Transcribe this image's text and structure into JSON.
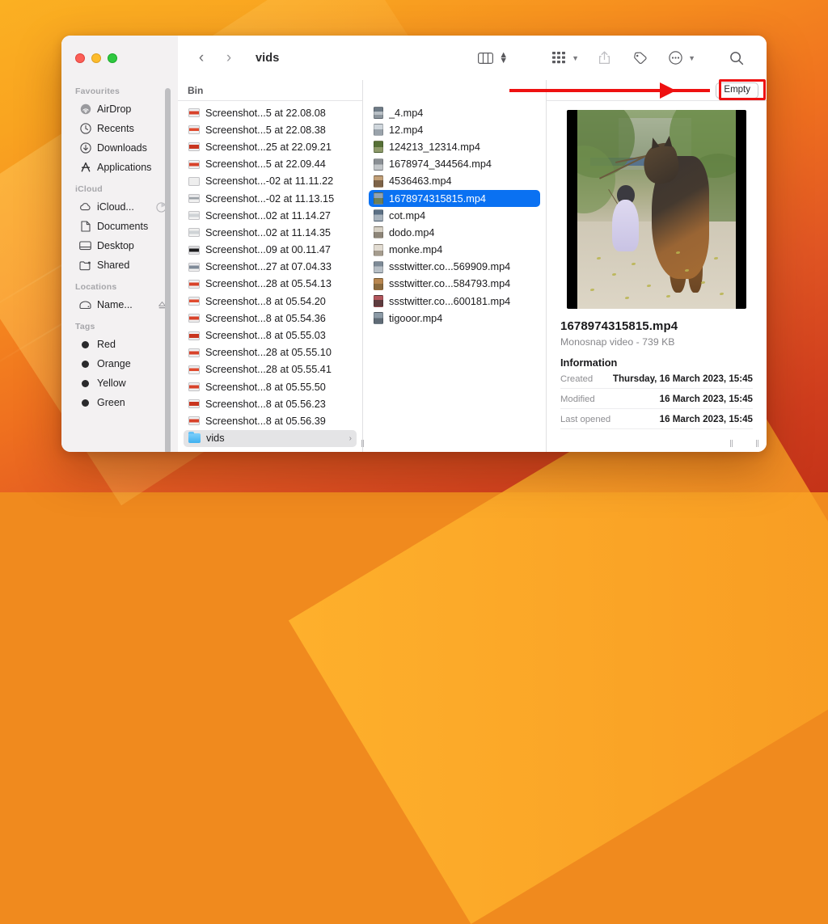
{
  "window": {
    "title": "vids",
    "traffic_lights": [
      "close",
      "minimize",
      "maximize"
    ]
  },
  "toolbar": {
    "back_icon": "chevron-left-icon",
    "forward_icon": "chevron-right-icon",
    "view_icon": "column-view-icon",
    "stepper_icon": "up-down-stepper-icon",
    "group_icon": "group-by-icon",
    "share_icon": "share-icon",
    "tag_icon": "tag-icon",
    "more_icon": "more-ellipsis-icon",
    "search_icon": "search-icon"
  },
  "bin_bar": {
    "title": "Bin",
    "empty_label": "Empty"
  },
  "sidebar": {
    "sections": [
      {
        "label": "Favourites",
        "items": [
          {
            "label": "AirDrop",
            "icon": "airdrop-icon"
          },
          {
            "label": "Recents",
            "icon": "clock-icon"
          },
          {
            "label": "Downloads",
            "icon": "download-icon"
          },
          {
            "label": "Applications",
            "icon": "applications-icon"
          }
        ]
      },
      {
        "label": "iCloud",
        "items": [
          {
            "label": "iCloud...",
            "icon": "cloud-icon",
            "trailing": "sync-progress-icon"
          },
          {
            "label": "Documents",
            "icon": "document-icon"
          },
          {
            "label": "Desktop",
            "icon": "desktop-icon"
          },
          {
            "label": "Shared",
            "icon": "shared-folder-icon"
          }
        ]
      },
      {
        "label": "Locations",
        "items": [
          {
            "label": "Name...",
            "icon": "drive-icon",
            "trailing": "eject-icon"
          }
        ]
      },
      {
        "label": "Tags",
        "items": [
          {
            "label": "Red",
            "icon": "tag-dot",
            "color": "#2a2a2c"
          },
          {
            "label": "Orange",
            "icon": "tag-dot",
            "color": "#2a2a2c"
          },
          {
            "label": "Yellow",
            "icon": "tag-dot",
            "color": "#2a2a2c"
          },
          {
            "label": "Green",
            "icon": "tag-dot",
            "color": "#2a2a2c"
          }
        ]
      }
    ]
  },
  "column_bin": {
    "items": [
      {
        "name": "Screenshot...5 at 22.08.08",
        "thumb": "shot-a"
      },
      {
        "name": "Screenshot...5 at 22.08.38",
        "thumb": "shot-b"
      },
      {
        "name": "Screenshot...25 at 22.09.21",
        "thumb": "shot-c"
      },
      {
        "name": "Screenshot...5 at 22.09.44",
        "thumb": "shot-a"
      },
      {
        "name": "Screenshot...-02 at 11.11.22",
        "thumb": "shot-d"
      },
      {
        "name": "Screenshot...-02 at 11.13.15",
        "thumb": "shot-e"
      },
      {
        "name": "Screenshot...02 at 11.14.27",
        "thumb": "shot-f"
      },
      {
        "name": "Screenshot...02 at 11.14.35",
        "thumb": "shot-f"
      },
      {
        "name": "Screenshot...09 at 00.11.47",
        "thumb": "shot-g"
      },
      {
        "name": "Screenshot...27 at 07.04.33",
        "thumb": "shot-h"
      },
      {
        "name": "Screenshot...28 at 05.54.13",
        "thumb": "shot-a"
      },
      {
        "name": "Screenshot...8 at 05.54.20",
        "thumb": "shot-b"
      },
      {
        "name": "Screenshot...8 at 05.54.36",
        "thumb": "shot-a"
      },
      {
        "name": "Screenshot...8 at 05.55.03",
        "thumb": "shot-c"
      },
      {
        "name": "Screenshot...28 at 05.55.10",
        "thumb": "shot-a"
      },
      {
        "name": "Screenshot...28 at 05.55.41",
        "thumb": "shot-b"
      },
      {
        "name": "Screenshot...8 at 05.55.50",
        "thumb": "shot-a"
      },
      {
        "name": "Screenshot...8 at 05.56.23",
        "thumb": "shot-c"
      },
      {
        "name": "Screenshot...8 at 05.56.39",
        "thumb": "shot-a"
      }
    ],
    "folder": {
      "name": "vids",
      "chevron": "chevron-right-icon"
    }
  },
  "column_vids": {
    "items": [
      {
        "name": "_4.mp4",
        "thumb": "vt-1"
      },
      {
        "name": "12.mp4",
        "thumb": "vt-2"
      },
      {
        "name": "124213_12314.mp4",
        "thumb": "vt-3"
      },
      {
        "name": "1678974_344564.mp4",
        "thumb": "vt-4"
      },
      {
        "name": "4536463.mp4",
        "thumb": "vt-5"
      },
      {
        "name": "1678974315815.mp4",
        "thumb": "vt-6",
        "selected": true
      },
      {
        "name": "cot.mp4",
        "thumb": "vt-7"
      },
      {
        "name": "dodo.mp4",
        "thumb": "vt-8"
      },
      {
        "name": "monke.mp4",
        "thumb": "vt-9"
      },
      {
        "name": "ssstwitter.co...569909.mp4",
        "thumb": "vt-10"
      },
      {
        "name": "ssstwitter.co...584793.mp4",
        "thumb": "vt-11"
      },
      {
        "name": "ssstwitter.co...600181.mp4",
        "thumb": "vt-12"
      },
      {
        "name": "tigooor.mp4",
        "thumb": "vt-13"
      }
    ]
  },
  "preview": {
    "image_alt": "german-shepherd-dog-and-child-video-thumbnail",
    "filename": "1678974315815.mp4",
    "subtitle": "Monosnap video - 739 KB",
    "section_title": "Information",
    "rows": [
      {
        "key": "Created",
        "value": "Thursday, 16 March 2023, 15:45"
      },
      {
        "key": "Modified",
        "value": "16 March 2023, 15:45"
      },
      {
        "key": "Last opened",
        "value": "16 March 2023, 15:45"
      }
    ]
  },
  "annotation": {
    "arrow": "red-arrow-pointing-right",
    "highlight": "red-box-around-empty-button",
    "color": "#ee1111"
  },
  "colors": {
    "selection_blue": "#0a71f2",
    "sidebar_bg": "#f3f1f2",
    "annotation_red": "#ee1111"
  }
}
